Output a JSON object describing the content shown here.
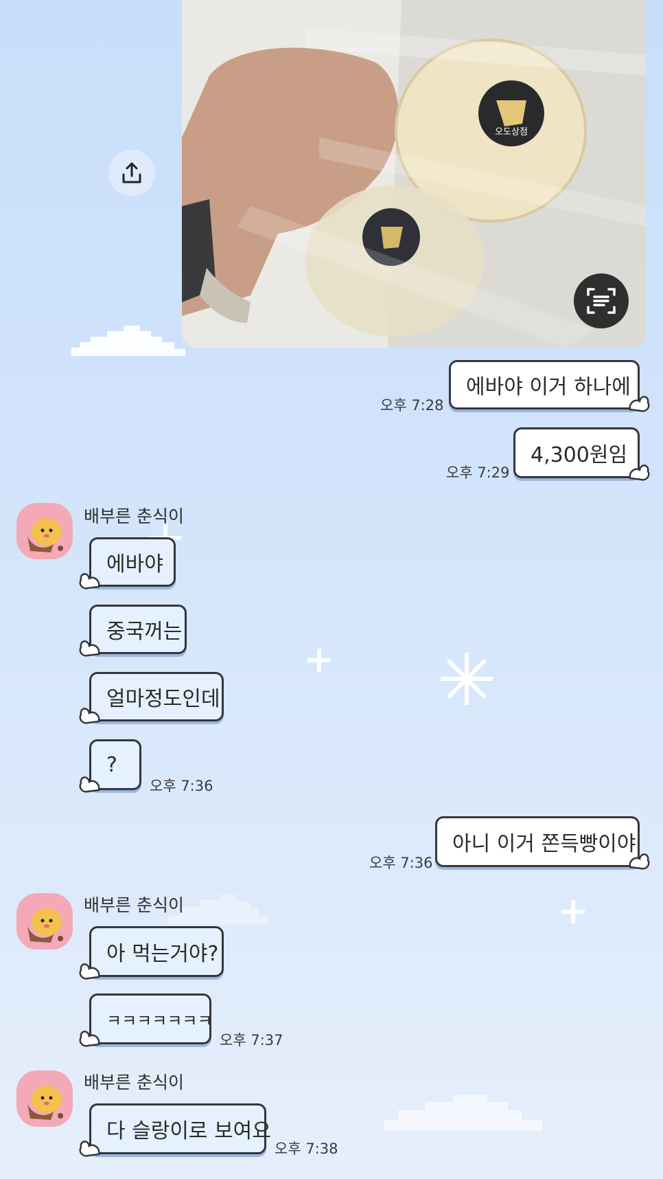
{
  "photo": {
    "sticker_text": "오도상점"
  },
  "messages": [
    {
      "side": "out",
      "text": "에바야 이거 하나에",
      "time": "오후 7:28"
    },
    {
      "side": "out",
      "text": "4,300원임",
      "time": "오후 7:29"
    },
    {
      "side": "in",
      "sender": "배부른 춘식이",
      "text": "에바야"
    },
    {
      "side": "in",
      "text": "중국꺼는"
    },
    {
      "side": "in",
      "text": "얼마정도인데"
    },
    {
      "side": "in",
      "text": "?",
      "time": "오후 7:36"
    },
    {
      "side": "out",
      "text": "아니 이거 쫀득빵이야",
      "time": "오후 7:36"
    },
    {
      "side": "in",
      "sender": "배부른 춘식이",
      "text": "아 먹는거야?"
    },
    {
      "side": "in",
      "text": "ㅋㅋㅋㅋㅋㅋㅋ",
      "time": "오후 7:37"
    },
    {
      "side": "in",
      "sender": "배부른 춘식이",
      "text": "다 슬랑이로 보여요",
      "time": "오후 7:38"
    }
  ],
  "icons": {
    "share": "upload-share-icon",
    "scan": "text-scan-icon",
    "avatar": "chunsik-avatar"
  },
  "colors": {
    "bubble_out": "#ffffff",
    "bubble_in": "#e5f1fe",
    "bubble_border": "#34363c",
    "avatar_bg": "#f3a9b6"
  }
}
